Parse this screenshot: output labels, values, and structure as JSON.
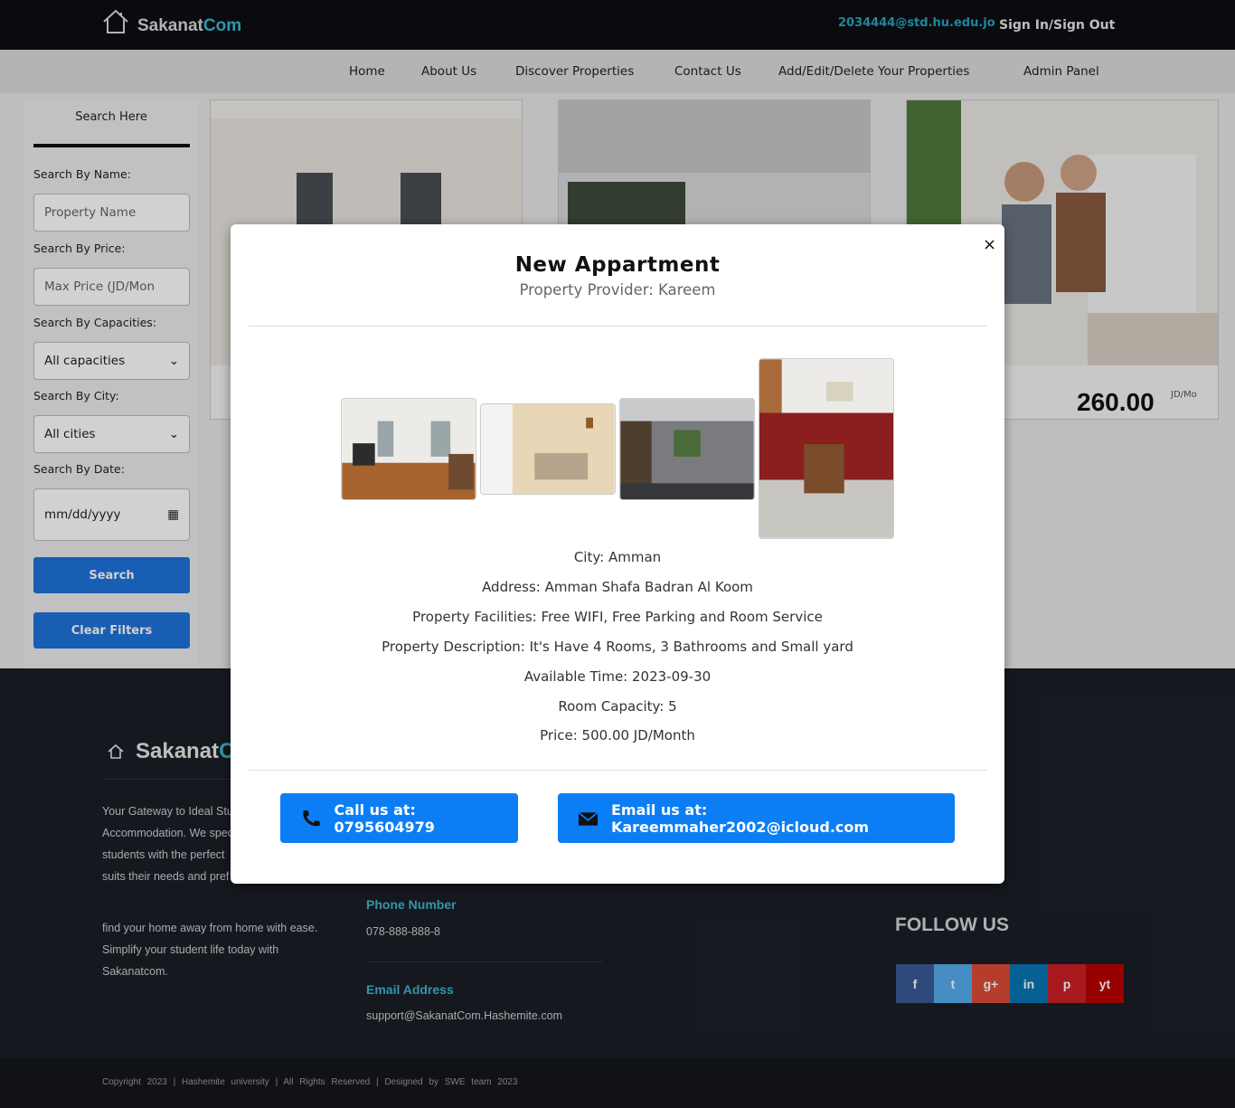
{
  "header": {
    "logo_main": "Sakanat",
    "logo_accent": "Com",
    "user_email": "2034444@std.hu.edu.jo",
    "sign_link": "Sign In/Sign Out"
  },
  "nav": [
    "Home",
    "About Us",
    "Discover Properties",
    "Contact Us",
    "Add/Edit/Delete Your Properties",
    "Admin Panel"
  ],
  "sidebar": {
    "title": "Search Here",
    "name_label": "Search By Name:",
    "name_placeholder": "Property Name",
    "price_label": "Search By Price:",
    "price_placeholder": "Max Price (JD/Mon",
    "capacity_label": "Search By Capacities:",
    "capacity_value": "All capacities",
    "city_label": "Search By City:",
    "city_value": "All cities",
    "date_label": "Search By Date:",
    "date_placeholder": "mm/dd/yyyy",
    "search_button": "Search",
    "clear_button": "Clear Filters"
  },
  "cards": [
    {
      "price": "",
      "unit": ""
    },
    {
      "price": "",
      "unit": ""
    },
    {
      "price": "260.00",
      "unit": "JD/Mo"
    }
  ],
  "modal": {
    "title": "New Appartment",
    "provider": "Property Provider: Kareem",
    "close": "×",
    "city": "City: Amman",
    "address": "Address: Amman Shafa Badran Al Koom",
    "facilities": "Property Facilities: Free WIFI, Free Parking and Room Service",
    "description": "Property Description: It's Have 4 Rooms, 3 Bathrooms and Small yard",
    "available": "Available Time: 2023-09-30",
    "capacity": "Room Capacity: 5",
    "price": "Price: 500.00 JD/Month",
    "call_button": "Call us at: 0795604979",
    "email_button": "Email us at: Kareemmaher2002@icloud.com",
    "thumbnails": [
      "bedroom-photo",
      "kids-room-photo",
      "studio-photo",
      "living-room-photo"
    ]
  },
  "footer": {
    "logo_main": "Sakanat",
    "logo_accent": "C",
    "about_line1": "Your Gateway to Ideal Stu",
    "about_line2": "Accommodation. We spec",
    "about_line3": "students with the perfect",
    "about_line4": "suits their needs and pref",
    "tag_line1": "find your home away from home with ease.",
    "tag_line2": "Simplify your student life today with",
    "tag_line3": "Sakanatcom.",
    "phone_heading": "Phone Number",
    "phone_value": "078-888-888-8",
    "email_heading": "Email Address",
    "email_value": "support@SakanatCom.Hashemite.com",
    "follow_heading": "FOLLOW US",
    "social": [
      {
        "icon": "f",
        "name": "facebook-icon",
        "color": "#3b5998"
      },
      {
        "icon": "t",
        "name": "twitter-icon",
        "color": "#55acee"
      },
      {
        "icon": "g+",
        "name": "google-plus-icon",
        "color": "#dd4b39"
      },
      {
        "icon": "in",
        "name": "linkedin-icon",
        "color": "#0976b4"
      },
      {
        "icon": "p",
        "name": "pinterest-icon",
        "color": "#cb2027"
      },
      {
        "icon": "yt",
        "name": "youtube-icon",
        "color": "#bb0000"
      }
    ],
    "copyright": "Copyright 2023 | Hashemite university | All Rights Reserved | Designed by SWE team 2023"
  }
}
